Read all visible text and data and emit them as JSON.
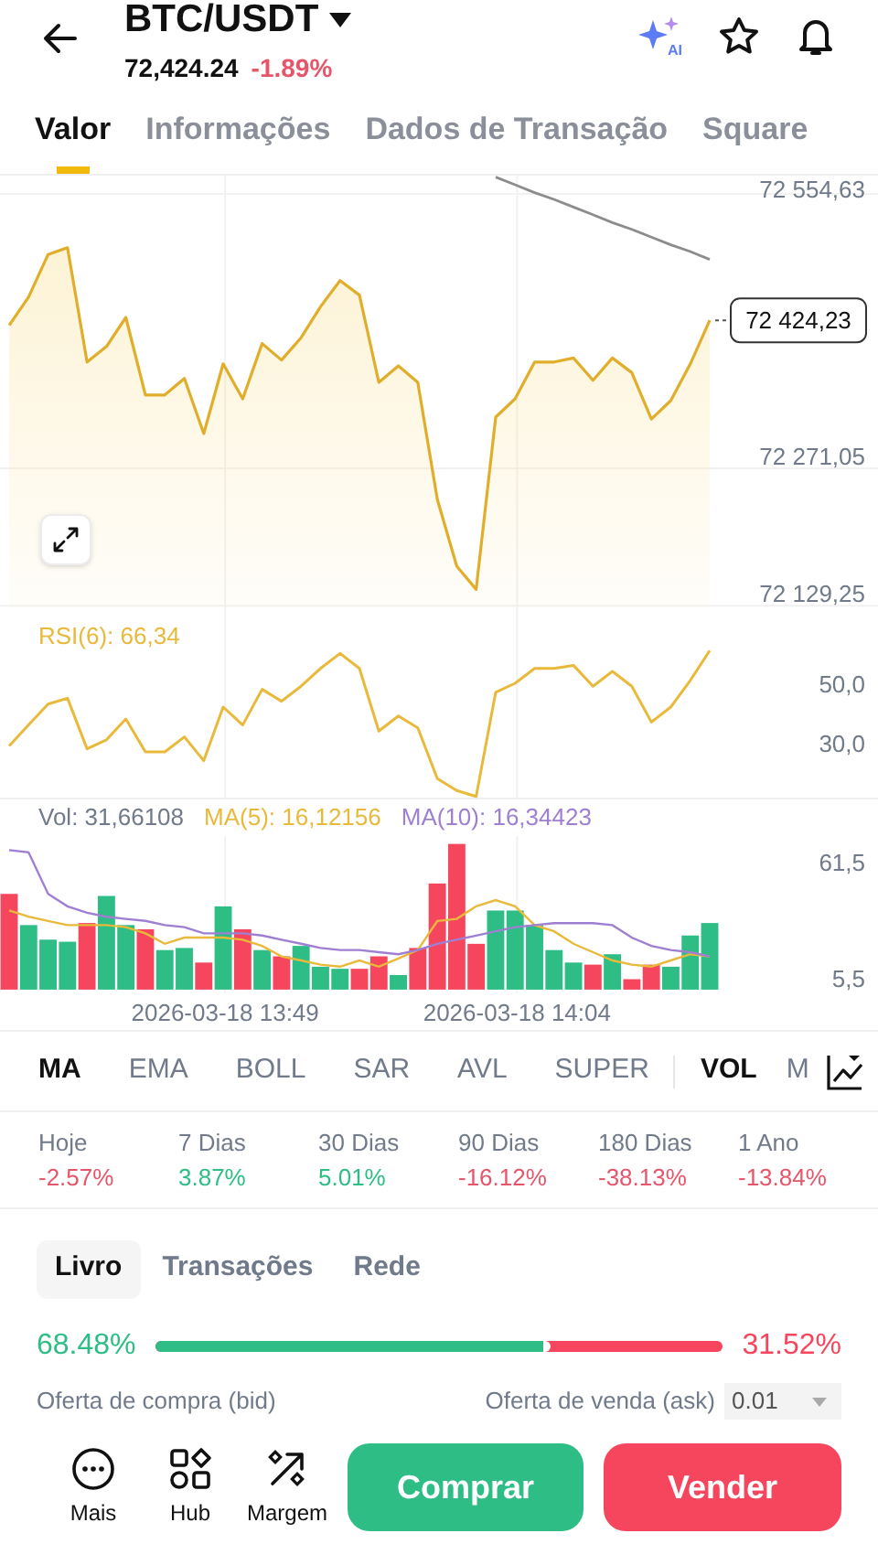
{
  "header": {
    "title": "BTC/USDT",
    "price": "72,424.24",
    "change": "-1.89%",
    "ai_label": "AI"
  },
  "tabs": [
    {
      "label": "Valor",
      "selected": true
    },
    {
      "label": "Informações",
      "selected": false
    },
    {
      "label": "Dados de Transação",
      "selected": false
    },
    {
      "label": "Square",
      "selected": false
    }
  ],
  "price_chart": {
    "price_tag": "72 424,23",
    "chart_data": {
      "type": "area",
      "grid": true,
      "ylim": [
        72127.5,
        72573.5
      ],
      "yticks": [
        {
          "value": 72554.63,
          "label": "72 554,63"
        },
        {
          "value": 72271.05,
          "label": "72 271,05"
        },
        {
          "value": 72129.25,
          "label": "72 129,25"
        }
      ],
      "series": [
        {
          "color": "#e0ae2a",
          "values": [
            72419,
            72448,
            72492,
            72499,
            72381,
            72397,
            72427,
            72347,
            72347,
            72364,
            72307,
            72379,
            72343,
            72400,
            72383,
            72406,
            72438,
            72465,
            72450,
            72360,
            72377,
            72360,
            72239,
            72170,
            72146,
            72324,
            72343,
            72381,
            72381,
            72385,
            72362,
            72385,
            72370,
            72322,
            72341,
            72379,
            72424
          ]
        },
        {
          "type": "line",
          "color": "#8c8c8c",
          "values": [
            null,
            null,
            null,
            null,
            null,
            null,
            null,
            null,
            null,
            null,
            null,
            null,
            null,
            null,
            null,
            null,
            null,
            null,
            null,
            null,
            null,
            null,
            null,
            null,
            null,
            72572,
            72564,
            72556,
            72549,
            72541,
            72533,
            72525,
            72518,
            72510,
            72502,
            72495,
            72487
          ]
        }
      ]
    }
  },
  "rsi_chart": {
    "chart_data": {
      "type": "line",
      "grid": true,
      "title": "RSI(6): 66,34",
      "ylim": [
        11,
        75.5
      ],
      "yticks": [
        {
          "value": 50,
          "label": "50,0"
        },
        {
          "value": 30,
          "label": "30,0"
        }
      ],
      "series": [
        {
          "color": "#e8b93a",
          "values": [
            29,
            36,
            43,
            45,
            28,
            31,
            38,
            27,
            27,
            32,
            24,
            42,
            36,
            48,
            44,
            49,
            55,
            60,
            55,
            34,
            39,
            35,
            18,
            14,
            12,
            47,
            50,
            55,
            55,
            56,
            49,
            54,
            49,
            37,
            42,
            51,
            61
          ]
        }
      ]
    }
  },
  "volume_chart": {
    "legend": [
      {
        "text": "Vol: 31,66108",
        "color": "#707a8a"
      },
      {
        "text": "MA(5): 16,12156",
        "color": "#e8b93a"
      },
      {
        "text": "MA(10): 16,34423",
        "color": "#9f7fd2"
      }
    ],
    "time_labels": [
      "2026-03-18 13:49",
      "2026-03-18 14:04"
    ],
    "chart_data": {
      "type": "bar",
      "grid": true,
      "ylim": [
        -1.8,
        73.8
      ],
      "yticks": [
        {
          "value": 61.5,
          "label": "61,5"
        },
        {
          "value": 5.5,
          "label": "5,5"
        }
      ],
      "series": [
        {
          "type": "bar",
          "color": "#2ebd85",
          "values": [
            null,
            31,
            24,
            23,
            null,
            45,
            31,
            null,
            19,
            20,
            null,
            40,
            null,
            19,
            null,
            21,
            11,
            10,
            null,
            null,
            7,
            null,
            null,
            null,
            null,
            38,
            38,
            31,
            19,
            13,
            null,
            17,
            null,
            null,
            11,
            26,
            32
          ]
        },
        {
          "type": "bar",
          "color": "#f6465d",
          "values": [
            46,
            null,
            null,
            null,
            32,
            null,
            null,
            29,
            null,
            null,
            13,
            null,
            29,
            null,
            16,
            null,
            null,
            null,
            10,
            16,
            null,
            20,
            51,
            70,
            22,
            null,
            null,
            null,
            null,
            null,
            12,
            null,
            5,
            12,
            null,
            null,
            null
          ]
        },
        {
          "type": "line",
          "color": "#e8b93a",
          "values": [
            38,
            35,
            33,
            31,
            31,
            31,
            30,
            27,
            22,
            25,
            25,
            25,
            24,
            21,
            16,
            14,
            12,
            11,
            14,
            11,
            15,
            19,
            33,
            34,
            40,
            43,
            40,
            31,
            28,
            22,
            18,
            14,
            12,
            11,
            14,
            17,
            16
          ]
        },
        {
          "type": "line",
          "color": "#9f7fd2",
          "values": [
            67,
            66,
            46,
            40,
            37,
            35,
            34,
            33,
            31,
            30,
            27,
            27,
            27,
            26,
            24,
            22,
            20,
            19,
            19,
            18,
            17,
            19,
            22,
            24,
            26,
            28,
            30,
            31,
            32,
            32,
            32,
            31,
            25,
            21,
            19,
            18,
            16
          ]
        }
      ]
    }
  },
  "indicators": {
    "main": [
      {
        "label": "MA",
        "selected": true
      },
      {
        "label": "EMA",
        "selected": false
      },
      {
        "label": "BOLL",
        "selected": false
      },
      {
        "label": "SAR",
        "selected": false
      },
      {
        "label": "AVL",
        "selected": false
      },
      {
        "label": "SUPER",
        "selected": false
      }
    ],
    "sub": [
      {
        "label": "VOL",
        "selected": true
      },
      {
        "label": "M",
        "selected": false
      }
    ]
  },
  "performance": [
    {
      "period": "Hoje",
      "change": "-2.57%",
      "color": "#e5566b"
    },
    {
      "period": "7 Dias",
      "change": "3.87%",
      "color": "#2ebd85"
    },
    {
      "period": "30 Dias",
      "change": "5.01%",
      "color": "#2ebd85"
    },
    {
      "period": "90 Dias",
      "change": "-16.12%",
      "color": "#e5566b"
    },
    {
      "period": "180 Dias",
      "change": "-38.13%",
      "color": "#e5566b"
    },
    {
      "period": "1 Ano",
      "change": "-13.84%",
      "color": "#e5566b"
    }
  ],
  "book_tabs": [
    {
      "label": "Livro",
      "selected": true
    },
    {
      "label": "Transações",
      "selected": false
    },
    {
      "label": "Rede",
      "selected": false
    }
  ],
  "ratio": {
    "bid": "68.48%",
    "ask": "31.52%",
    "level": 0.6848
  },
  "book_header": {
    "bid_label": "Oferta de compra (bid)",
    "ask_label": "Oferta de venda (ask)",
    "precision": "0.01"
  },
  "footer": {
    "actions": [
      {
        "label": "Mais",
        "kind": "more"
      },
      {
        "label": "Hub",
        "kind": "hub"
      },
      {
        "label": "Margem",
        "kind": "margin"
      }
    ],
    "buy": "Comprar",
    "sell": "Vender"
  }
}
